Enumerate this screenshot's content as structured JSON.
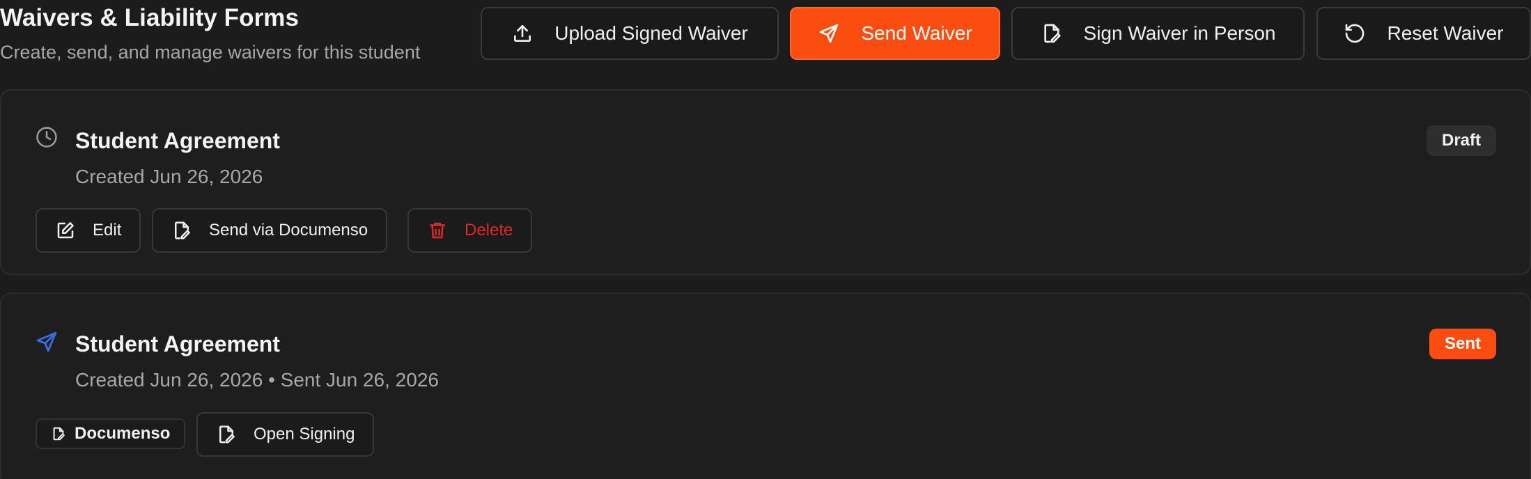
{
  "header": {
    "title": "Waivers & Liability Forms",
    "subtitle": "Create, send, and manage waivers for this student"
  },
  "toolbar": {
    "upload_label": "Upload Signed Waiver",
    "send_label": "Send Waiver",
    "sign_in_person_label": "Sign Waiver in Person",
    "reset_label": "Reset Waiver"
  },
  "waivers": [
    {
      "title": "Student Agreement",
      "meta": "Created Jun 26, 2026",
      "status": "Draft",
      "icon": "clock-icon",
      "actions": {
        "edit": "Edit",
        "send": "Send via Documenso",
        "delete": "Delete"
      }
    },
    {
      "title": "Student Agreement",
      "meta": "Created Jun 26, 2026 • Sent Jun 26, 2026",
      "status": "Sent",
      "icon": "send-icon",
      "provider": "Documenso",
      "actions": {
        "open": "Open Signing"
      }
    }
  ],
  "colors": {
    "accent": "#fa4d0f",
    "danger": "#d92b2b",
    "sent_icon": "#3b6fe0",
    "background": "#1c1c1c"
  }
}
